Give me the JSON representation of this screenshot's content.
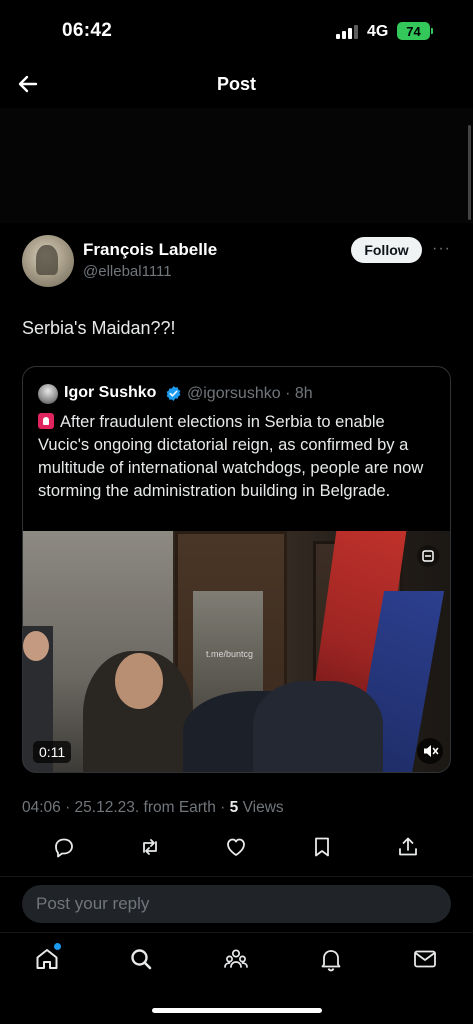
{
  "status_bar": {
    "time": "06:42",
    "network": "4G",
    "battery": "74"
  },
  "header": {
    "title": "Post",
    "back_icon": "arrow-left-icon"
  },
  "tweet": {
    "author_name": "François Labelle",
    "author_handle": "@ellebal1111",
    "follow_label": "Follow",
    "more_label": "···",
    "text": "Serbia's Maidan??!",
    "timestamp": "04:06 · 25.12.23. from Earth · ",
    "views_count": "5",
    "views_label": " Views"
  },
  "quote": {
    "author_name": "Igor Sushko",
    "verified": true,
    "author_handle": "@igorsushko · 8h",
    "text": "After fraudulent elections in Serbia to enable Vucic's ongoing dictatorial reign, as confirmed by a multitude of international watchdogs, people are now storming the administration building in Belgrade.",
    "video": {
      "watermark": "t.me/buntcg",
      "duration": "0:11"
    }
  },
  "actions": [
    {
      "name": "reply-icon"
    },
    {
      "name": "repost-icon"
    },
    {
      "name": "like-icon"
    },
    {
      "name": "bookmark-icon"
    },
    {
      "name": "share-icon"
    }
  ],
  "reply": {
    "placeholder": "Post your reply"
  },
  "bottom_nav": [
    {
      "name": "home-icon",
      "active": true
    },
    {
      "name": "search-icon"
    },
    {
      "name": "communities-icon"
    },
    {
      "name": "notifications-icon"
    },
    {
      "name": "messages-icon"
    }
  ],
  "colors": {
    "background": "#000000",
    "text": "#e7e9ea",
    "secondary": "#71767b",
    "accent": "#1d9bf0",
    "battery": "#34c759"
  }
}
